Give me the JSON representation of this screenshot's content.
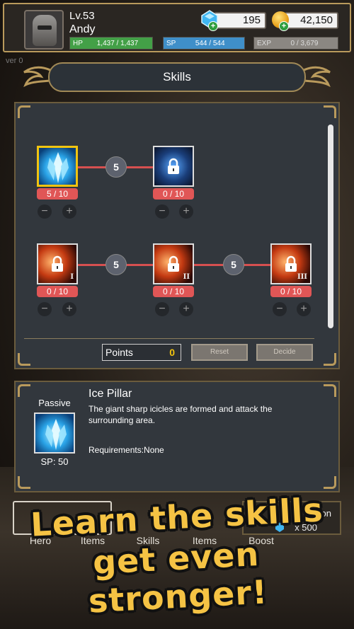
{
  "header": {
    "level": "Lv.53",
    "player_name": "Andy",
    "hp_label": "HP",
    "hp_value": "1,437 / 1,437",
    "sp_label": "SP",
    "sp_value": "544 / 544",
    "exp_label": "EXP",
    "exp_value": "0 / 3,679",
    "gems": "195",
    "gold": "42,150"
  },
  "version_label": "ver 0",
  "title": "Skills",
  "skill_tree": {
    "links": [
      "5",
      "5",
      "5"
    ],
    "skills": [
      {
        "name": "ice-pillar",
        "level": "5 / 10",
        "locked": false
      },
      {
        "name": "blue-orb",
        "level": "0 / 10",
        "locked": true
      },
      {
        "name": "fire-1",
        "level": "0 / 10",
        "locked": true,
        "tier": "I"
      },
      {
        "name": "fire-2",
        "level": "0 / 10",
        "locked": true,
        "tier": "II"
      },
      {
        "name": "fire-3",
        "level": "0 / 10",
        "locked": true,
        "tier": "III"
      }
    ],
    "minus": "−",
    "plus": "+",
    "points_label": "Points",
    "points_value": "0",
    "reset_label": "Reset",
    "decide_label": "Decide"
  },
  "detail": {
    "type": "Passive",
    "sp_cost": "SP: 50",
    "name": "Ice Pillar",
    "description": "The giant sharp icicles are formed and attack the surrounding area.",
    "requirements": "Requirements:None"
  },
  "nav": {
    "tabs": [
      "Hero",
      "Items",
      "Skills",
      "Items",
      "Boost"
    ],
    "promo_title": "tion",
    "promo_amount": "x 500"
  },
  "slogan": {
    "line1": "Learn the skills",
    "line2": "get even stronger!"
  },
  "colors": {
    "accent_gold": "#b99a5c",
    "hp": "#43a047",
    "sp": "#3f8fc9",
    "level_badge": "#e05656",
    "slogan": "#f5c344"
  }
}
